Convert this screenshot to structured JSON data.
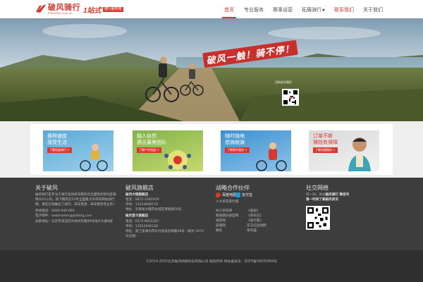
{
  "header": {
    "logo_cn": "破风骑行",
    "logo_en": "POFENG.com.cn",
    "slogan_big": "1站式",
    "slogan_small": "骑行服务商",
    "nav": [
      {
        "label": "首页",
        "active": true
      },
      {
        "label": "专业服务"
      },
      {
        "label": "赛事运营"
      },
      {
        "label": "拓展骑行",
        "caret": "▼"
      },
      {
        "label": "联系我们",
        "highlight": true
      },
      {
        "label": "关于我们"
      }
    ]
  },
  "hero": {
    "title": "破风一触！骑不停！",
    "qr_caption": "扫码关注我们"
  },
  "cards": [
    {
      "line1": "换种速度",
      "line2": "感受生活",
      "button": "了解拓展骑行 >",
      "color_a": "#5aa9d6",
      "color_b": "#9fd0ec"
    },
    {
      "line1": "融入自然",
      "line2": "遇见最美团队",
      "button": "了解户外拓展 >",
      "color_a": "#7fb44a",
      "color_b": "#c7d86f"
    },
    {
      "line1": "随时随地",
      "line2": "想骑就骑",
      "button": "了解租车服务 >",
      "color_a": "#3b8fd0",
      "color_b": "#8cc3ea"
    },
    {
      "line1": "订单不断",
      "line2": "赚钱有保障",
      "button": "了解加盟服务 >",
      "color_a": "#d9d9d9",
      "color_b": "#f2f2f2"
    }
  ],
  "footer": {
    "about": {
      "title": "关于破风",
      "text": "破风骑行是专注于骑行运动单车服务的全国性的移动互联网O2O公司。旗下拥有近10年全国最大的单车网站骑行网，目前已经推出了骑行、单车旅游、单车租赁等业务！",
      "phone": "热线电话：4006-040-660",
      "email": "电子邮件：webmaster@pofeng.com",
      "address": "总部地址：北京市海淀区中关村东路89号恒兴大厦9层"
    },
    "stores": {
      "title": "破风旗舰店",
      "s1_name": "破风大理旗舰店",
      "s1_phone": "电话：0872-2581919",
      "s1_mobile": "手机：13334946178",
      "s1_addr": "地址：云南省大理市古城区博爱路56号",
      "s2_name": "破风昆卡旗舰店",
      "s2_phone": "电话：0572-6051267",
      "s2_mobile": "手机：13522942228",
      "s2_addr": "地址：浙江省湖州市长兴县吴昌硕路48号（奥村-1972文化街）"
    },
    "partners": {
      "title": "战略合作伙伴",
      "logo1": "百度地图",
      "logo2": "支付宝",
      "logo_caption": "十大单车旅行城",
      "links": [
        "共三单车网",
        "《骑迹》",
        "铁骑俱乐部官网",
        "《单车志》",
        "骑友网",
        "《骑行家》",
        "美骑网",
        "东方红运动网",
        "贼车",
        "单车猫"
      ]
    },
    "social": {
      "title": "社交网络",
      "text1": "扫一扫，关注",
      "text1b": "破风骑行 微信号",
      "text2": "第一时间了解破风资讯"
    },
    "copyright": "©2014-2015北京破风网络科技有限公司 版权所有 网站备案号：京ICP备09035064号"
  },
  "colors": {
    "accent": "#d9382d",
    "footer_bg": "#3d3d3d",
    "footer_bottom": "#2f2f2f"
  }
}
